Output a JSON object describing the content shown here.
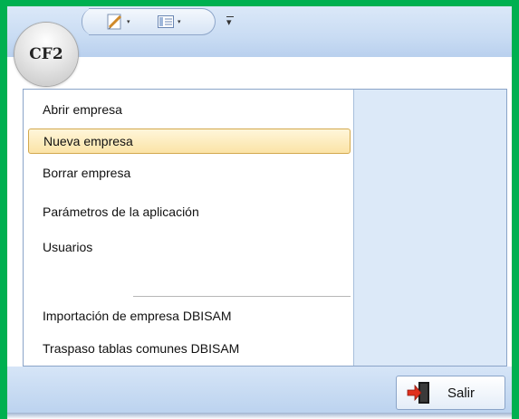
{
  "app": {
    "orb_label": "CF2"
  },
  "qat": {
    "icons": [
      "edit-icon",
      "view-icon"
    ],
    "dropdown_glyph": "▾",
    "more_glyph": "▾"
  },
  "menu": {
    "items": [
      "Abrir empresa",
      "Nueva empresa",
      "Borrar empresa",
      "Parámetros de la aplicación",
      "Usuarios",
      "Importación de empresa DBISAM",
      "Traspaso tablas comunes DBISAM"
    ],
    "selected": "Nueva empresa"
  },
  "footer": {
    "exit_label": "Salir",
    "exit_icon": "exit-door-icon"
  },
  "colors": {
    "accent_border": "#00b050",
    "selection": "#fbe3a6"
  }
}
